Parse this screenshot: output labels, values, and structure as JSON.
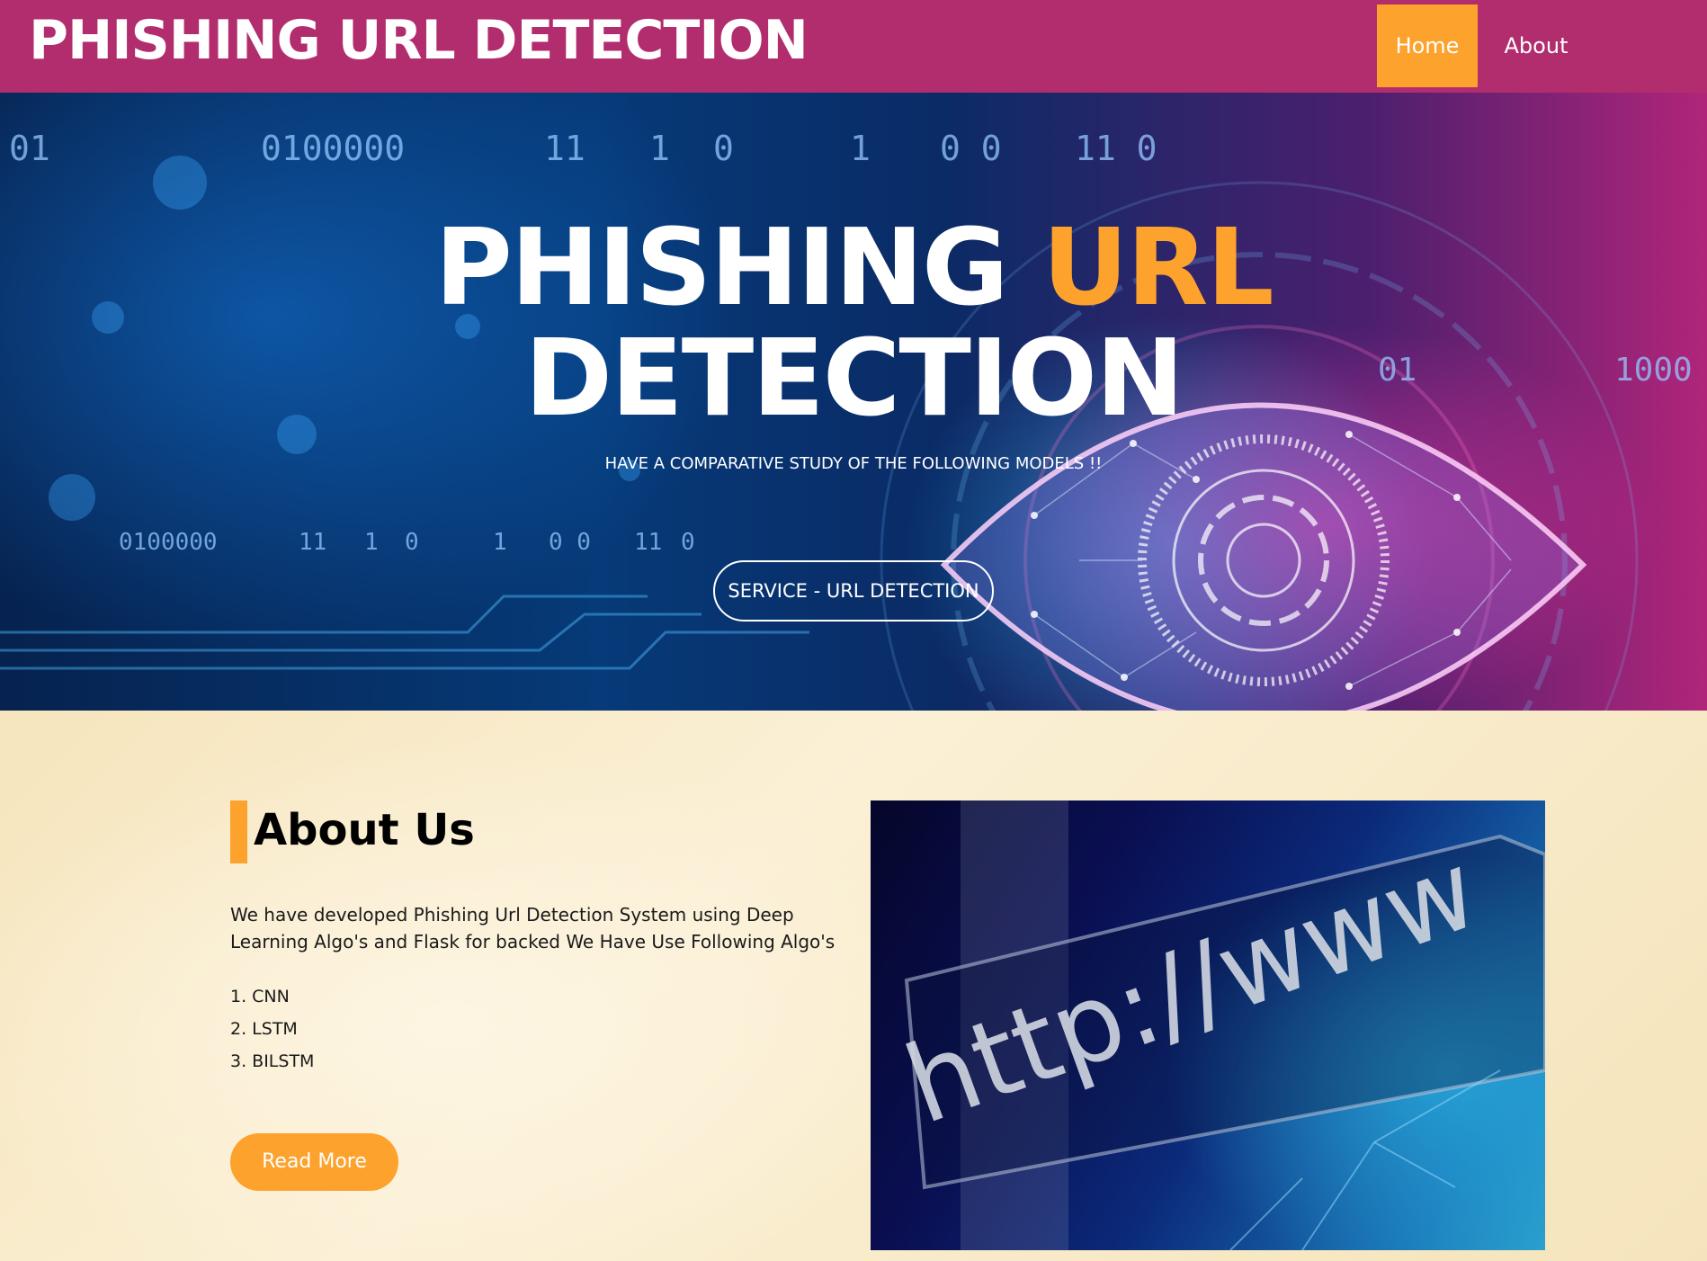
{
  "navbar": {
    "brand": "PHISHING URL DETECTION",
    "items": [
      {
        "label": "Home",
        "active": true
      },
      {
        "label": "About",
        "active": false
      }
    ],
    "background_color": "#b22d6e",
    "active_color": "#fda22c"
  },
  "hero": {
    "title_part1": "PHISHING ",
    "title_accent": "URL",
    "title_line2": "DETECTION",
    "subtitle": "HAVE A COMPARATIVE STUDY OF THE FOLLOWING MODELS !!",
    "button_label": "SERVICE - URL DETECTION",
    "binary": {
      "top_row": [
        "01",
        "0100000",
        "11",
        "1",
        "0",
        "1",
        "0 0",
        "11 0"
      ],
      "bottom_row": [
        "0100000",
        "11",
        "1",
        "0",
        "1",
        "0 0",
        "11",
        "0"
      ],
      "right": [
        "01",
        "1000"
      ]
    },
    "accent_color": "#fda22c"
  },
  "about": {
    "title": "About Us",
    "description": "We have developed Phishing Url Detection System using Deep Learning Algo's and Flask for backed We Have Use Following Algo's",
    "algorithms": [
      "1. CNN",
      "2. LSTM",
      "3. BILSTM"
    ],
    "button_label": "Read More",
    "image_text": "http://www",
    "accent_color": "#fda22c"
  }
}
